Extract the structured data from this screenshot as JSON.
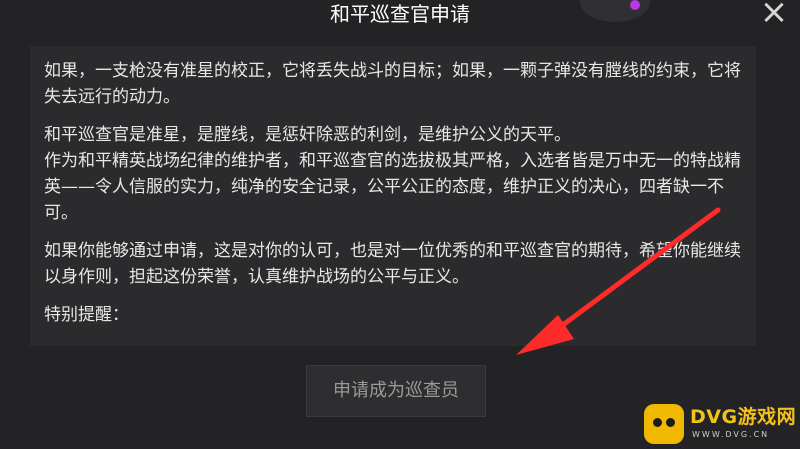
{
  "dialog": {
    "title": "和平巡查官申请",
    "close_symbol": "×",
    "paragraphs": [
      "如果，一支枪没有准星的校正，它将丢失战斗的目标；如果，一颗子弹没有膛线的约束，它将失去远行的动力。",
      "和平巡查官是准星，是膛线，是惩奸除恶的利剑，是维护公义的天平。",
      "作为和平精英战场纪律的维护者，和平巡查官的选拔极其严格，入选者皆是万中无一的特战精英——令人信服的实力，纯净的安全记录，公平公正的态度，维护正义的决心，四者缺一不可。",
      "如果你能够通过申请，这是对你的认可，也是对一位优秀的和平巡查官的期待，希望你能继续以身作则，担起这份荣誉，认真维护战场的公平与正义。",
      "特别提醒："
    ],
    "apply_button": "申请成为巡查员"
  },
  "watermark": {
    "brand": "DVG游戏网",
    "url": "WWW.DVG.CN"
  },
  "colors": {
    "background": "#232325",
    "panel": "#2b2b2d",
    "arrow": "#ff2a2a",
    "watermark": "#f2c21a"
  }
}
